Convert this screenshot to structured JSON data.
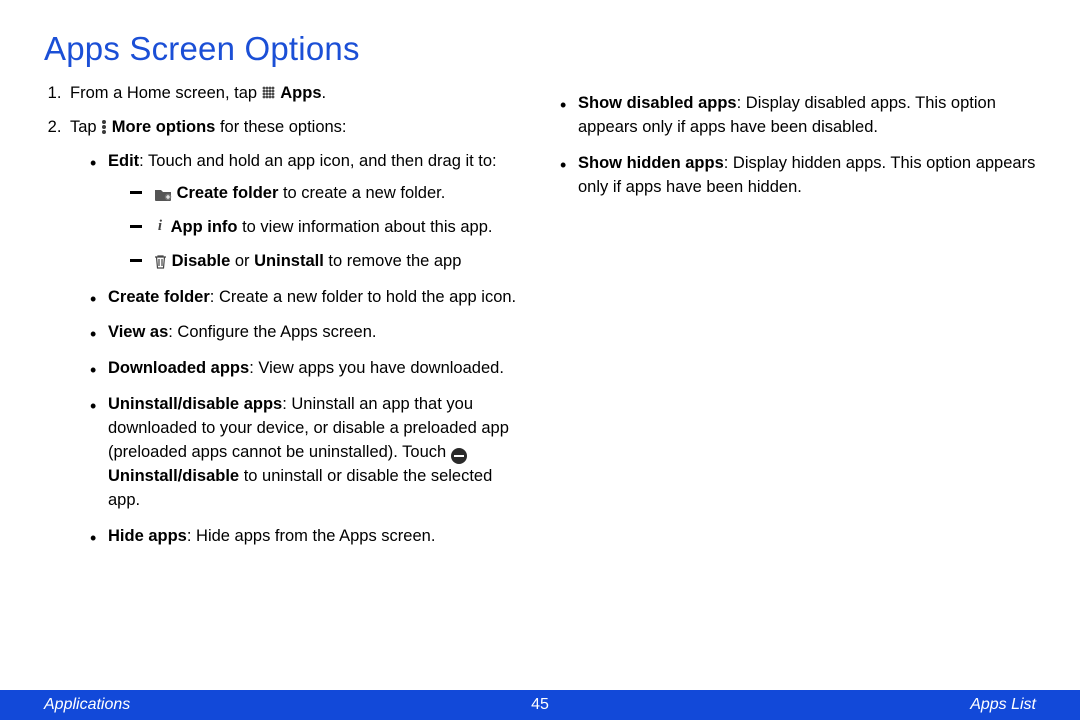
{
  "title": "Apps Screen Options",
  "steps": {
    "s1_pre": "From a Home screen, tap ",
    "s1_apps": "Apps",
    "s1_post": ".",
    "s2_pre": "Tap ",
    "s2_more": "More options",
    "s2_post": " for these options:"
  },
  "edit": {
    "label": "Edit",
    "text": ": Touch and hold an app icon, and then drag it to:",
    "sub": {
      "folder_b": "Create folder",
      "folder_t": " to create a new folder.",
      "info_b": "App info",
      "info_t": " to view information about this app.",
      "disable_b1": "Disable",
      "disable_mid": " or ",
      "disable_b2": "Uninstall",
      "disable_t": " to remove the app"
    }
  },
  "items": {
    "cf_b": "Create folder",
    "cf_t": ": Create a new folder to hold the app icon.",
    "va_b": "View as",
    "va_t": ": Configure the Apps screen.",
    "dl_b": "Downloaded apps",
    "dl_t": ": View apps you have downloaded.",
    "ud_b": "Uninstall/disable apps",
    "ud_t1": ": Uninstall an app that you downloaded to your device, or disable a preloaded app (preloaded apps cannot be uninstalled). Touch ",
    "ud_b2": "Uninstall/disable",
    "ud_t2": " to uninstall or disable the selected app.",
    "hide_b": "Hide apps",
    "hide_t": ": Hide apps from the Apps screen."
  },
  "col2": {
    "sd_b": "Show disabled apps",
    "sd_t": ": Display disabled apps. This option appears only if apps have been disabled.",
    "sh_b": "Show hidden apps",
    "sh_t": ": Display hidden apps. This option appears only if apps have been hidden."
  },
  "footer": {
    "left": "Applications",
    "page": "45",
    "right": "Apps List"
  }
}
